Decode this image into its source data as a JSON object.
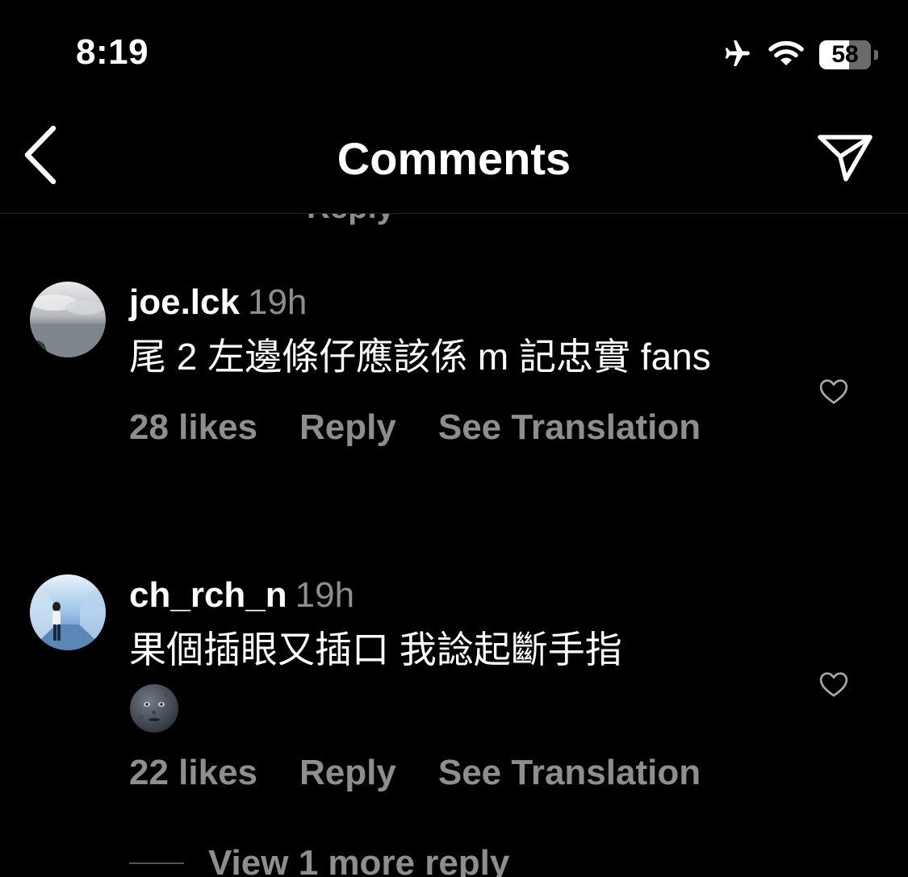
{
  "status_bar": {
    "time": "8:19",
    "battery_level": "58",
    "battery_fraction": 0.58,
    "icons": [
      "airplane-mode-icon",
      "wifi-icon",
      "battery-icon"
    ]
  },
  "header": {
    "title": "Comments",
    "back_icon": "chevron-left-icon",
    "share_icon": "paper-plane-icon"
  },
  "comments": [
    {
      "username": "joe.lck",
      "time": "19h",
      "text": "尾 2 左邊條仔應該係 m 記忠實 fans",
      "likes": "28 likes",
      "reply_label": "Reply",
      "translate_label": "See Translation"
    },
    {
      "username": "ch_rch_n",
      "time": "19h",
      "text": "果個插眼又插口 我諗起斷手指",
      "emoji": "new-moon-face-emoji",
      "likes": "22 likes",
      "reply_label": "Reply",
      "translate_label": "See Translation"
    }
  ],
  "view_more": "View 1 more reply",
  "colors": {
    "background": "#000000",
    "primary_text": "#ffffff",
    "secondary_text": "#8e8e8e",
    "divider": "#262626"
  }
}
